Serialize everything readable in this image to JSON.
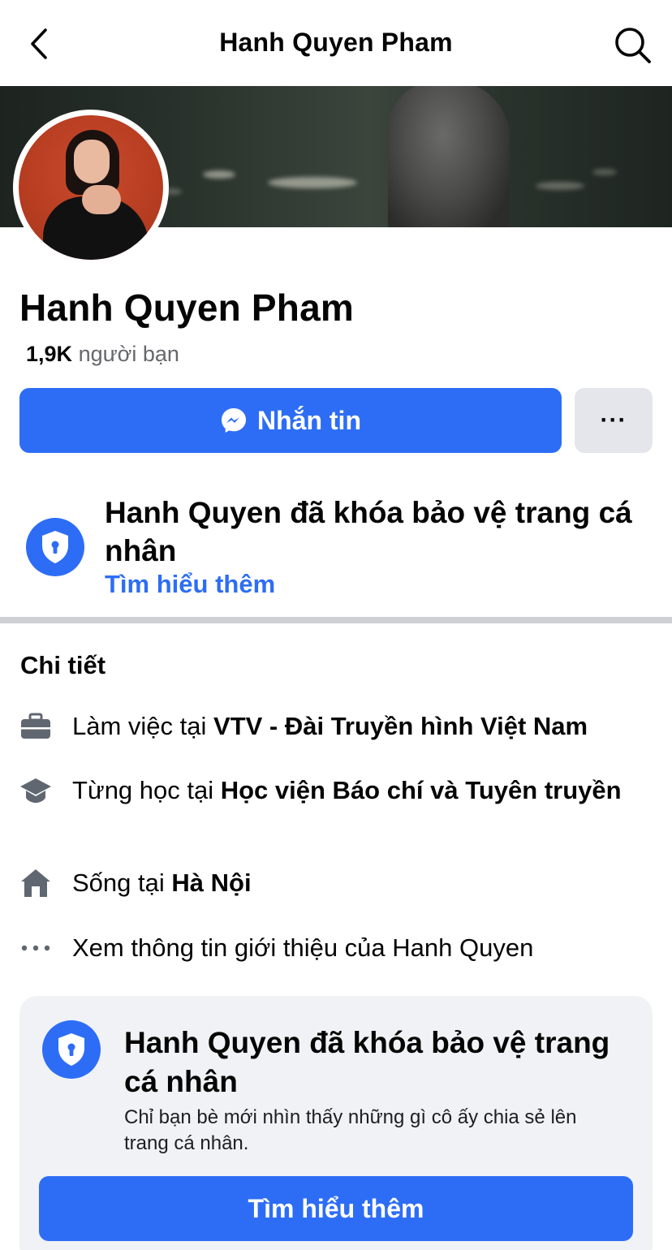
{
  "header": {
    "title": "Hanh Quyen Pham",
    "back_icon": "chevron-left-icon",
    "search_icon": "search-icon"
  },
  "profile": {
    "name": "Hanh Quyen Pham",
    "friends_count": "1,9K",
    "friends_label": "người bạn"
  },
  "actions": {
    "message_label": "Nhắn tin",
    "message_icon": "messenger-icon",
    "more_label": "···"
  },
  "lock_notice": {
    "title": "Hanh Quyen đã khóa bảo vệ trang cá nhân",
    "link": "Tìm hiểu thêm",
    "icon": "shield-lock-icon"
  },
  "details": {
    "title": "Chi tiết",
    "items": [
      {
        "icon": "briefcase-icon",
        "prefix": "Làm việc tại ",
        "value": "VTV - Đài Truyền hình Việt Nam"
      },
      {
        "icon": "graduation-cap-icon",
        "prefix": "Từng học tại ",
        "value": "Học viện Báo chí và Tuyên truyền"
      },
      {
        "icon": "home-icon",
        "prefix": "Sống tại ",
        "value": "Hà Nội"
      },
      {
        "icon": "more-dots-icon",
        "prefix": "Xem thông tin giới thiệu của Hanh Quyen",
        "value": ""
      }
    ]
  },
  "lock_card": {
    "title": "Hanh Quyen đã khóa bảo vệ trang cá nhân",
    "description": "Chỉ bạn bè mới nhìn thấy những gì cô ấy chia sẻ lên trang cá nhân.",
    "button_label": "Tìm hiểu thêm"
  },
  "colors": {
    "accent": "#2d6df6",
    "secondary_button": "#e4e6eb",
    "divider": "#ced0d4",
    "card_bg": "#f0f2f5"
  }
}
